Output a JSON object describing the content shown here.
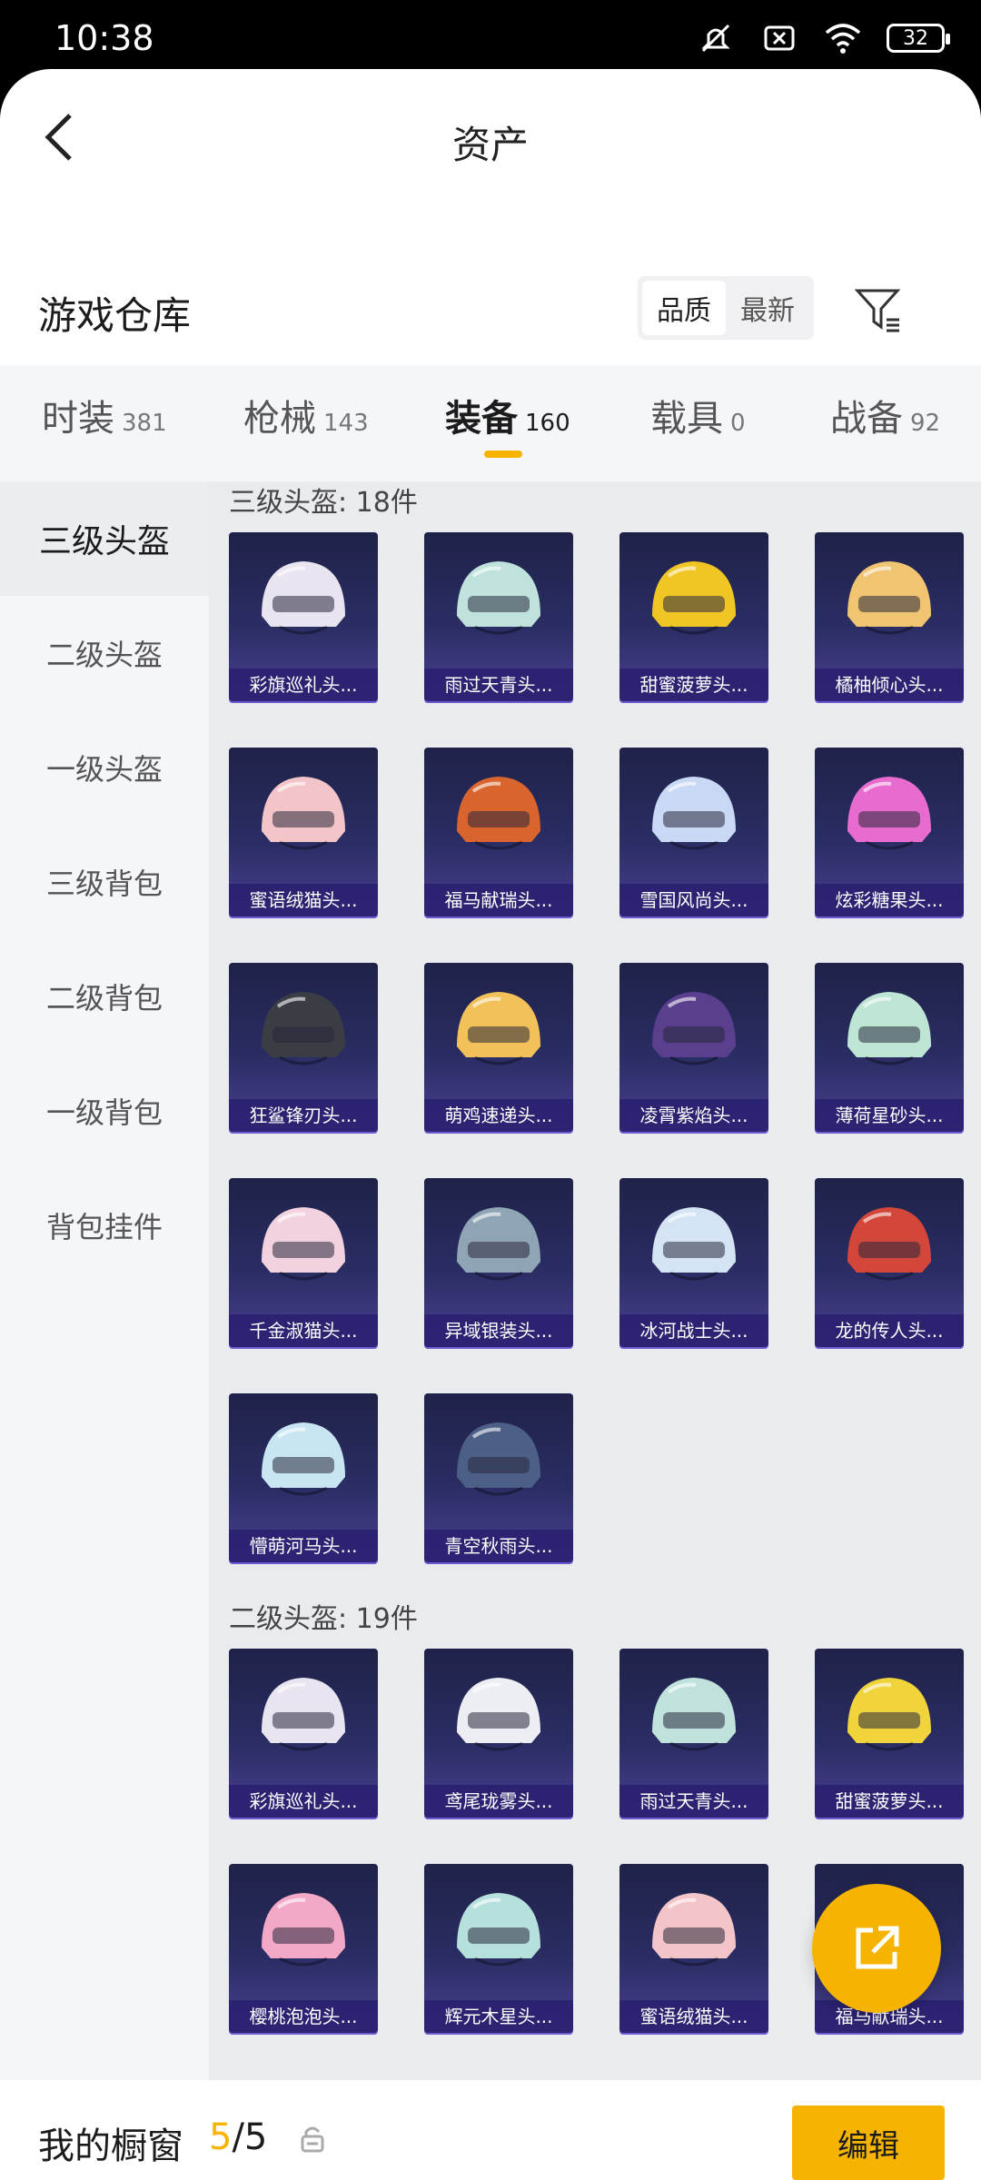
{
  "status": {
    "time": "10:38",
    "battery": "32"
  },
  "header": {
    "title": "资产"
  },
  "warehouse": {
    "title": "游戏仓库",
    "sort_options": [
      "品质",
      "最新"
    ]
  },
  "tabs": [
    {
      "label": "时装",
      "count": "381"
    },
    {
      "label": "枪械",
      "count": "143"
    },
    {
      "label": "装备",
      "count": "160"
    },
    {
      "label": "载具",
      "count": "0"
    },
    {
      "label": "战备",
      "count": "92"
    }
  ],
  "sidebar": [
    "三级头盔",
    "二级头盔",
    "一级头盔",
    "三级背包",
    "二级背包",
    "一级背包",
    "背包挂件"
  ],
  "sections": [
    {
      "title": "三级头盔: 18件",
      "items": [
        {
          "label": "彩旗巡礼头...",
          "color": "#e8e4f0"
        },
        {
          "label": "雨过天青头...",
          "color": "#bfe3dc"
        },
        {
          "label": "甜蜜菠萝头...",
          "color": "#f1c624"
        },
        {
          "label": "橘柚倾心头...",
          "color": "#f0c470"
        },
        {
          "label": "蜜语绒猫头...",
          "color": "#f4c5c8"
        },
        {
          "label": "福马献瑞头...",
          "color": "#d9642e"
        },
        {
          "label": "雪国风尚头...",
          "color": "#c9d8f4"
        },
        {
          "label": "炫彩糖果头...",
          "color": "#e86ccf"
        },
        {
          "label": "狂鲨锋刃头...",
          "color": "#3a3d44"
        },
        {
          "label": "萌鸡速递头...",
          "color": "#f2c15a"
        },
        {
          "label": "凌霄紫焰头...",
          "color": "#5a3f8f"
        },
        {
          "label": "薄荷星砂头...",
          "color": "#bfe6d4"
        },
        {
          "label": "千金淑猫头...",
          "color": "#f3d2e0"
        },
        {
          "label": "异域银装头...",
          "color": "#8fa4b4"
        },
        {
          "label": "冰河战士头...",
          "color": "#d4e4f4"
        },
        {
          "label": "龙的传人头...",
          "color": "#d2473a"
        },
        {
          "label": "懵萌河马头...",
          "color": "#c8e6f2"
        },
        {
          "label": "青空秋雨头...",
          "color": "#4c5f86"
        }
      ]
    },
    {
      "title": "二级头盔: 19件",
      "items": [
        {
          "label": "彩旗巡礼头...",
          "color": "#e8e4f0"
        },
        {
          "label": "鸢尾珑雾头...",
          "color": "#eceef4"
        },
        {
          "label": "雨过天青头...",
          "color": "#bfe3dc"
        },
        {
          "label": "甜蜜菠萝头...",
          "color": "#f1d43c"
        },
        {
          "label": "樱桃泡泡头...",
          "color": "#f4a8c8"
        },
        {
          "label": "辉元木星头...",
          "color": "#b6e0dc"
        },
        {
          "label": "蜜语绒猫头...",
          "color": "#f4c5c8"
        },
        {
          "label": "福马献瑞头...",
          "color": "#d9642e"
        }
      ]
    }
  ],
  "bottom": {
    "showcase_label": "我的橱窗",
    "showcase_used": "5",
    "showcase_total": "/5",
    "edit_label": "编辑"
  },
  "colors": {
    "accent": "#f6b400",
    "card_bg": "#2a2d63"
  }
}
